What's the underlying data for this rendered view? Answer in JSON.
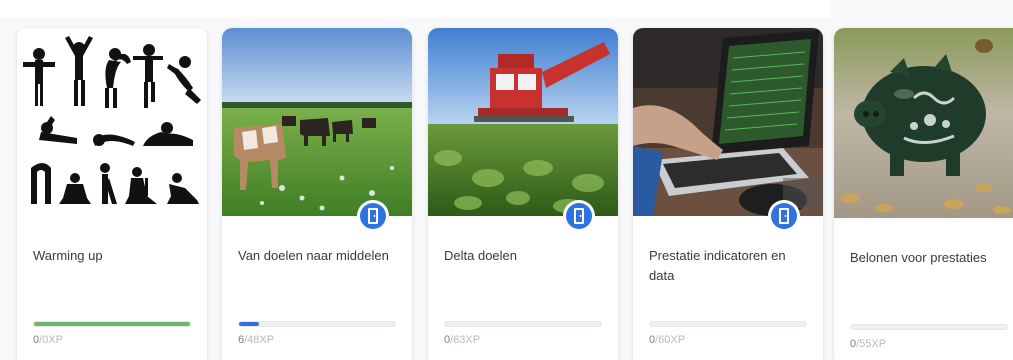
{
  "cards": [
    {
      "title": "Warming up",
      "image": "silhouettes-exercise",
      "badge_icon": null,
      "progress": {
        "earned": "0",
        "total": "/0",
        "unit": "XP",
        "fraction": 1.0,
        "color": "#6db56d"
      }
    },
    {
      "title": "Van doelen naar middelen",
      "image": "cows-in-field",
      "badge_icon": "door-icon",
      "progress": {
        "earned": "6",
        "total": "/48",
        "unit": "XP",
        "fraction": 0.125,
        "color": "#3a6fd8"
      }
    },
    {
      "title": "Delta doelen",
      "image": "beet-harvester",
      "badge_icon": "door-icon",
      "progress": {
        "earned": "0",
        "total": "/63",
        "unit": "XP",
        "fraction": 0.0,
        "color": "#3a6fd8"
      }
    },
    {
      "title": "Prestatie indicatoren en data",
      "image": "laptop-typing",
      "badge_icon": "door-icon",
      "progress": {
        "earned": "0",
        "total": "/60",
        "unit": "XP",
        "fraction": 0.0,
        "color": "#3a6fd8"
      }
    },
    {
      "title": "Belonen voor prestaties",
      "image": "piggy-bank-coins",
      "badge_icon": null,
      "progress": {
        "earned": "0",
        "total": "/55",
        "unit": "XP",
        "fraction": 0.0,
        "color": "#3a6fd8"
      }
    }
  ],
  "colors": {
    "badge_blue": "#2f73e0",
    "progress_green": "#6db56d",
    "progress_blue": "#3a6fd8"
  }
}
